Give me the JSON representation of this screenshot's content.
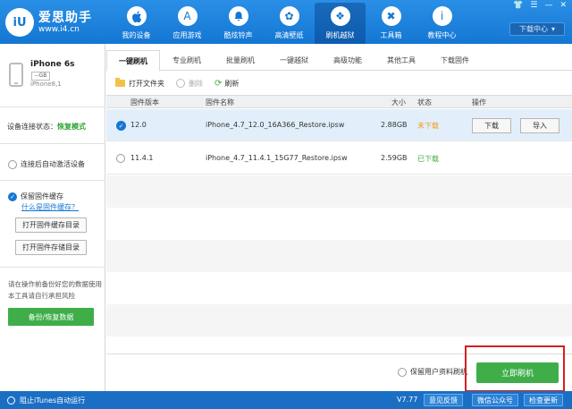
{
  "app": {
    "logo_mark": "iU",
    "name": "爱思助手",
    "url": "www.i4.cn",
    "window_controls": [
      "👕",
      "☰",
      "—",
      "✕"
    ]
  },
  "nav": [
    {
      "label": "我的设备",
      "icon": "apple-icon",
      "glyph": ""
    },
    {
      "label": "应用游戏",
      "icon": "app-store-icon",
      "glyph": "A"
    },
    {
      "label": "酷炫铃声",
      "icon": "bell-icon",
      "glyph": "🔔"
    },
    {
      "label": "高清壁纸",
      "icon": "flower-icon",
      "glyph": "✿"
    },
    {
      "label": "刷机越狱",
      "icon": "dropbox-icon",
      "glyph": "❖"
    },
    {
      "label": "工具箱",
      "icon": "tools-icon",
      "glyph": "✖"
    },
    {
      "label": "教程中心",
      "icon": "info-icon",
      "glyph": "i"
    }
  ],
  "download_center": "下载中心",
  "device": {
    "name": "iPhone 6s",
    "capacity": "--GB",
    "model": "iPhone8,1"
  },
  "sidebar": {
    "status_label": "设备连接状态：",
    "status_value": "恢复模式",
    "auto_activate": "连接后自动激活设备",
    "keep_cache": "保留固件缓存",
    "what_is_cache": "什么是固件缓存？",
    "open_cache_dir": "打开固件缓存目录",
    "open_store_dir": "打开固件存储目录",
    "note": "请在操作前备份好您的数据使用本工具请自行承担风险",
    "backup_btn": "备份/恢复数据"
  },
  "tabs": [
    "一键刷机",
    "专业刷机",
    "批量刷机",
    "一键越狱",
    "高级功能",
    "其他工具",
    "下载固件"
  ],
  "toolbar": {
    "open_folder": "打开文件夹",
    "delete": "删除",
    "refresh": "刷新"
  },
  "table": {
    "headers": {
      "version": "固件版本",
      "name": "固件名称",
      "size": "大小",
      "status": "状态",
      "action": "操作"
    },
    "rows": [
      {
        "version": "12.0",
        "name": "iPhone_4.7_12.0_16A366_Restore.ipsw",
        "size": "2.88GB",
        "status": "未下载",
        "btn_download": "下载",
        "btn_import": "导入"
      },
      {
        "version": "11.4.1",
        "name": "iPhone_4.7_11.4.1_15G77_Restore.ipsw",
        "size": "2.59GB",
        "status": "已下载"
      }
    ]
  },
  "bottom": {
    "keep_user_data": "保留用户资料刷机",
    "flash_now": "立即刷机"
  },
  "statusbar": {
    "block_itunes": "阻止iTunes自动运行",
    "version": "V7.77",
    "feedback": "意见反馈",
    "wechat": "微信公众号",
    "update": "检查更新"
  },
  "colors": {
    "header_blue": "#1477d3",
    "accent_green": "#3fae49",
    "status_orange": "#f29a1c",
    "highlight_red": "#d42020"
  }
}
